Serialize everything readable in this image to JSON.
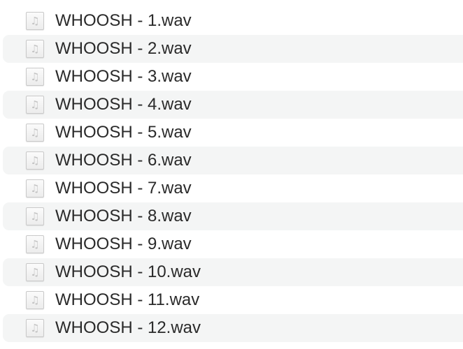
{
  "file_list": {
    "icon": "audio-file-icon",
    "icon_glyph": "♫",
    "items": [
      {
        "name": "WHOOSH - 1.wav"
      },
      {
        "name": "WHOOSH - 2.wav"
      },
      {
        "name": "WHOOSH - 3.wav"
      },
      {
        "name": "WHOOSH - 4.wav"
      },
      {
        "name": "WHOOSH - 5.wav"
      },
      {
        "name": "WHOOSH - 6.wav"
      },
      {
        "name": "WHOOSH - 7.wav"
      },
      {
        "name": "WHOOSH - 8.wav"
      },
      {
        "name": "WHOOSH - 9.wav"
      },
      {
        "name": "WHOOSH - 10.wav"
      },
      {
        "name": "WHOOSH - 11.wav"
      },
      {
        "name": "WHOOSH - 12.wav"
      }
    ]
  },
  "colors": {
    "row_alternate": "#f4f5f5",
    "text": "#2a2a2a",
    "icon_border": "#c9c9c9"
  }
}
